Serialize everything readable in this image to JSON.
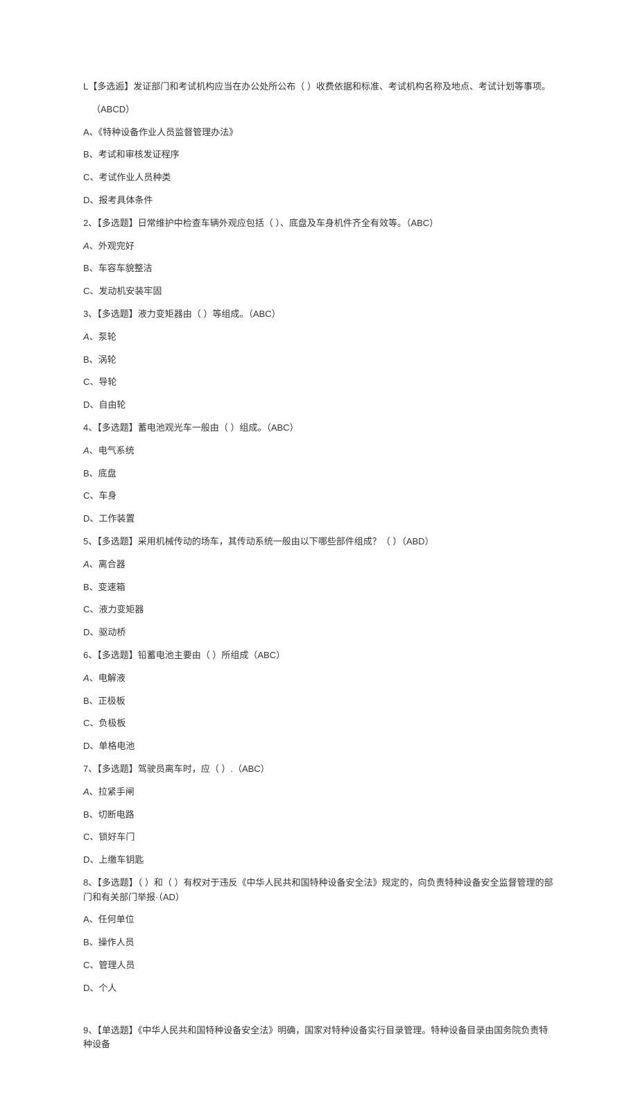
{
  "questions": [
    {
      "stem_lines": [
        "L【多选逅】发证部门和考试机构应当在办公处所公布（ ）收费依据和标准、考试机构名称及地点、考试计划等事项。"
      ],
      "answer": "（ABCD）",
      "options": [
        "A、《特种设备作业人员监督管理办法》",
        "B、考试和审核发证程序",
        "C、考试作业人员种类",
        "D、报考具体条件"
      ]
    },
    {
      "stem_lines": [
        "2、【多选题】日常维护中检查车辆外观应包括（ ）、底盘及车身机件齐全有效等。（ABC）"
      ],
      "answer": "",
      "options": [
        "A、外观完好",
        "B、车容车貌整洁",
        "C、发动机安装牢固"
      ]
    },
    {
      "stem_lines": [
        "3、【多选题】液力变矩器由（ ）等组成。（ABC）"
      ],
      "answer": "",
      "options": [
        "A、泵轮",
        "B、涡轮",
        "C、导轮",
        "D、自由轮"
      ]
    },
    {
      "stem_lines": [
        "4、【多选题】蓄电池观光车一般由（ ）组成。（ABC）"
      ],
      "answer": "",
      "options": [
        "A、电气系统",
        "B、底盘",
        "C、车身",
        "D、工作装置"
      ]
    },
    {
      "stem_lines": [
        "5、【多选题】采用机械传动的场车，其传动系统一般由以下哪些部件组成？（ ）（ABD）"
      ],
      "answer": "",
      "options": [
        "A、离合器",
        "B、变速箱",
        "C、液力变矩器",
        "D、驱动桥"
      ]
    },
    {
      "stem_lines": [
        "6、【多选题】铅蓄电池主要由（ ）所组成（ABC）"
      ],
      "answer": "",
      "options": [
        "A、电解液",
        "B、正极板",
        "C、负极板",
        "D、单格电池"
      ]
    },
    {
      "stem_lines": [
        "7、【多选题】驾驶员离车时，应（ ）.（ABC）"
      ],
      "answer": "",
      "options": [
        "A、拉紧手闸",
        "B、切断电路",
        "C、锁好车门",
        "D、上缴车钥匙"
      ]
    },
    {
      "stem_lines": [
        "8、【多选题】（ ）和（ ）有权对于违反《中华人民共和国特种设备安全法》规定的，向负责特种设备安全监督管理的部门和有关部门举报·（AD）"
      ],
      "answer": "",
      "options": [
        "A、任何单位",
        "B、操作人员",
        "C、管理人员",
        "D、个人"
      ]
    },
    {
      "stem_lines": [
        "9、【单选题】《中华人民共和国特种设备安全法》明确，国家对特种设备实行目录管理。特种设备目录由国务院负责特种设备"
      ],
      "answer": "",
      "options": []
    }
  ]
}
